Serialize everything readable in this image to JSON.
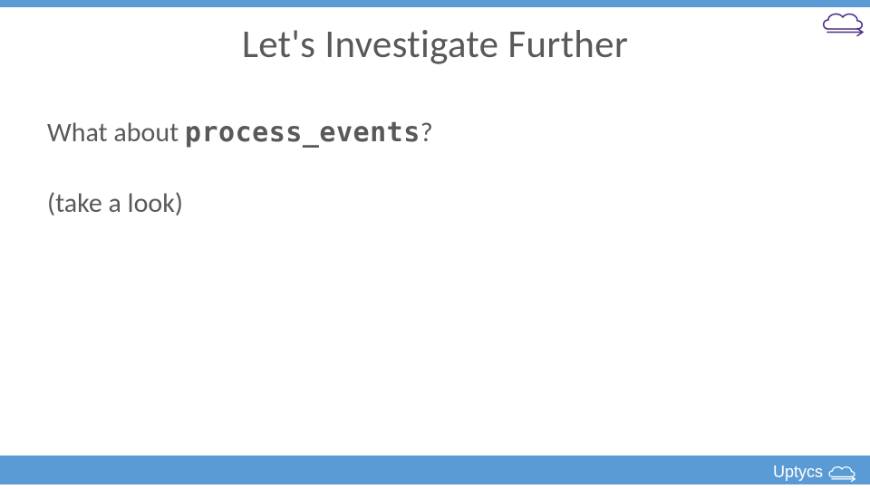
{
  "title": "Let's Investigate Further",
  "body": {
    "line1_prefix": "What about ",
    "line1_code": "process_events",
    "line1_suffix": "?",
    "line2": "(take a look)"
  },
  "footer": {
    "brand": "Uptycs"
  }
}
